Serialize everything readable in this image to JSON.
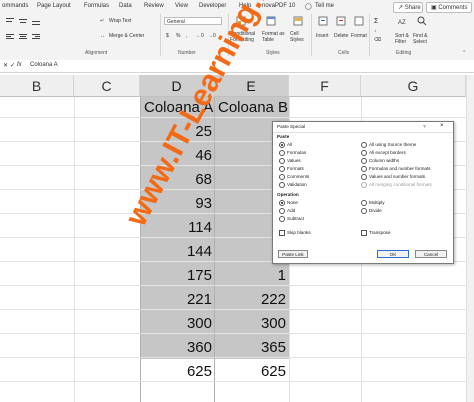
{
  "ribbon": {
    "tabs": [
      "ommands",
      "Page Layout",
      "Formulas",
      "Data",
      "Review",
      "View",
      "Developer",
      "Help",
      "novaPDF 10"
    ],
    "tell_me": "Tell me",
    "share": "Share",
    "comments": "Comments",
    "wrap_text": "Wrap Text",
    "merge_center": "Merge & Center",
    "number_format": "General",
    "currency_symbol": "$",
    "percent_symbol": "%",
    "comma_symbol": ",",
    "cond_format": "Conditional Formatting",
    "format_table": "Format as Table",
    "cell_styles": "Cell Styles",
    "insert": "Insert",
    "delete": "Delete",
    "format": "Format",
    "sort_filter": "Sort & Filter",
    "find_select": "Find & Select",
    "groups": {
      "alignment": "Alignment",
      "number": "Number",
      "styles": "Styles",
      "cells": "Cells",
      "editing": "Editing"
    }
  },
  "formula_bar": {
    "fx": "fx",
    "content": "Coloana A"
  },
  "columns": [
    "B",
    "C",
    "D",
    "E",
    "F",
    "G"
  ],
  "sheet": {
    "header_a": "Coloana A",
    "header_b": "Coloana B",
    "col_a": [
      "25",
      "46",
      "68",
      "93",
      "114",
      "144",
      "175",
      "221",
      "300",
      "360",
      "625"
    ],
    "col_b": [
      "",
      "",
      "",
      "",
      "1",
      "1",
      "1",
      "222",
      "300",
      "365",
      "625"
    ]
  },
  "dialog": {
    "title": "Paste Special",
    "help": "?",
    "close": "×",
    "paste_label": "Paste",
    "paste_left": [
      "All",
      "Formulas",
      "Values",
      "Formats",
      "Comments",
      "Validation"
    ],
    "paste_right": [
      "All using Source theme",
      "All except borders",
      "Column widths",
      "Formulas and number formats",
      "Values and number formats",
      "All merging conditional formats"
    ],
    "operation_label": "Operation",
    "op_left": [
      "None",
      "Add",
      "Subtract"
    ],
    "op_right": [
      "Multiply",
      "Divide"
    ],
    "skip_blanks": "Skip blanks",
    "transpose": "Transpose",
    "paste_link": "Paste Link",
    "ok": "OK",
    "cancel": "Cancel"
  },
  "watermark": "www.IT-Learning.ro",
  "colors": {
    "watermark": "#f26a16",
    "selection": "#c6c6c6",
    "ok_border": "#2a6ed6"
  }
}
